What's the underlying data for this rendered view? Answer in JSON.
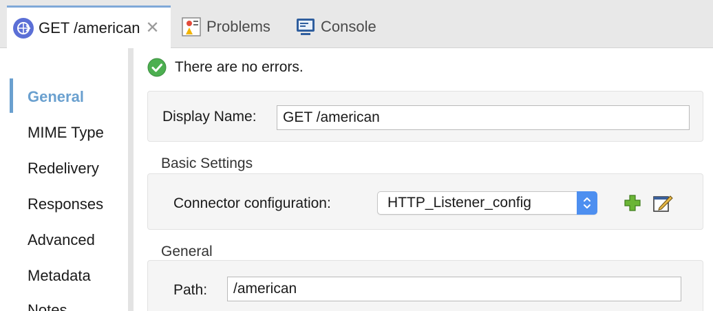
{
  "tabs": [
    {
      "label": "GET /american",
      "icon": "http-listener-icon",
      "active": true,
      "closable": true
    },
    {
      "label": "Problems",
      "icon": "problems-icon"
    },
    {
      "label": "Console",
      "icon": "console-icon"
    }
  ],
  "sidebar": {
    "items": [
      {
        "label": "General",
        "active": true
      },
      {
        "label": "MIME Type"
      },
      {
        "label": "Redelivery"
      },
      {
        "label": "Responses"
      },
      {
        "label": "Advanced"
      },
      {
        "label": "Metadata"
      },
      {
        "label": "Notes"
      }
    ]
  },
  "status": {
    "text": "There are no errors.",
    "icon": "check-circle-icon",
    "color": "#4caf50"
  },
  "display_name": {
    "label": "Display Name:",
    "value": "GET /american"
  },
  "basic_settings": {
    "title": "Basic Settings",
    "connector_label": "Connector configuration:",
    "connector_value": "HTTP_Listener_config"
  },
  "general_section": {
    "title": "General",
    "path_label": "Path:",
    "path_value": "/american"
  },
  "colors": {
    "accent": "#6aa0cf",
    "select_stepper": "#4d8ff0",
    "add_green": "#6bb536"
  }
}
